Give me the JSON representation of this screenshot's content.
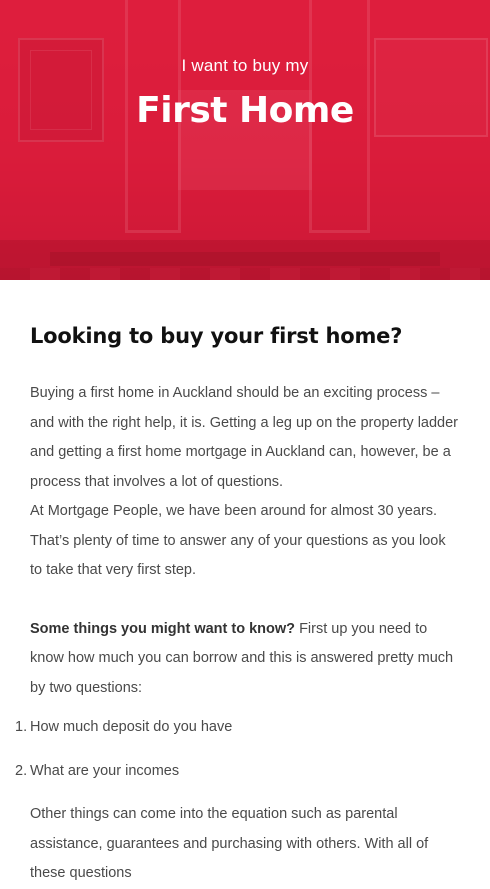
{
  "hero": {
    "subtitle": "I want to buy my",
    "title": "First Home",
    "accent_color": "#e0213f"
  },
  "main": {
    "heading": "Looking to buy your first home?",
    "intro_paragraph_1": "Buying a first home in Auckland should be an exciting process – and with the right help, it is. Getting a leg up on the property ladder and getting a first home mortgage in Auckland can, however, be a process that involves a lot of questions.",
    "intro_paragraph_2": "At Mortgage People, we have been around for almost 30 years. That’s plenty of time to answer any of your questions as you look to take that very first step.",
    "know_lead_bold": "Some things you might want to know?",
    "know_lead_rest": "First up you need to know how much you can borrow and this is answered pretty much by two questions:",
    "list": [
      {
        "num": "1.",
        "text": "How much deposit do you have"
      },
      {
        "num": "2.",
        "text": "What are your incomes"
      }
    ],
    "outro": "Other things can come into the equation such as parental assistance, guarantees and purchasing with others. With all of these questions"
  }
}
